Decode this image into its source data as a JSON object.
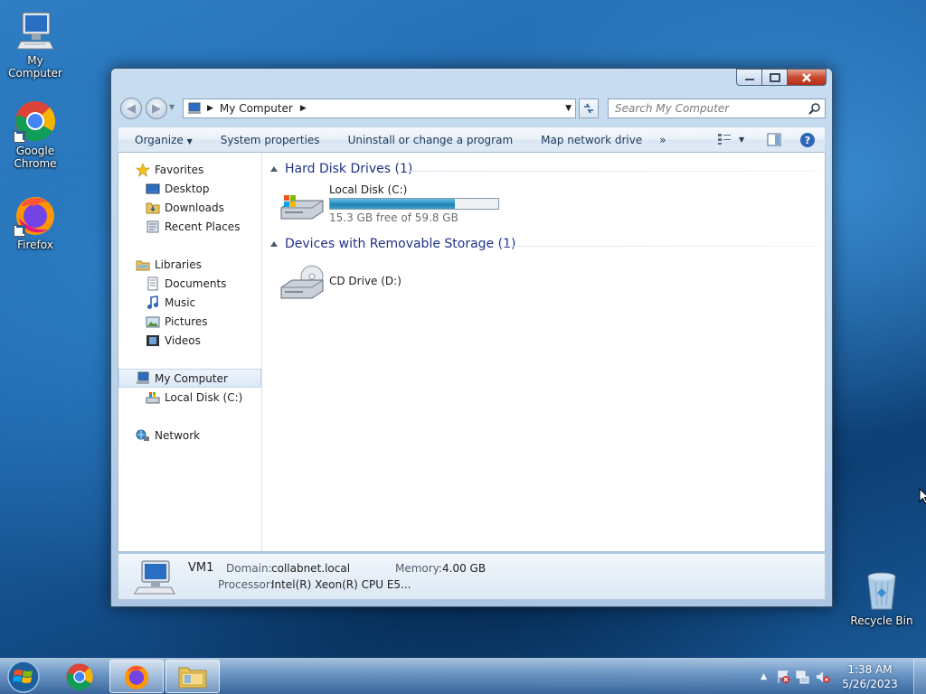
{
  "desktop": {
    "icons": [
      {
        "label": "My Computer",
        "icon": "computer-icon"
      },
      {
        "label": "Google Chrome",
        "icon": "chrome-icon"
      },
      {
        "label": "Firefox",
        "icon": "firefox-icon"
      },
      {
        "label": "Recycle Bin",
        "icon": "recycle-bin-icon"
      }
    ]
  },
  "window": {
    "title_buttons": [
      "minimize",
      "maximize",
      "close"
    ],
    "address": {
      "location": "My Computer"
    },
    "search": {
      "placeholder": "Search My Computer"
    },
    "toolbar": {
      "organize": "Organize",
      "system_properties": "System properties",
      "uninstall": "Uninstall or change a program",
      "map_drive": "Map network drive",
      "more": "»"
    },
    "nav": {
      "favorites": "Favorites",
      "desktop": "Desktop",
      "downloads": "Downloads",
      "recent": "Recent Places",
      "libraries": "Libraries",
      "documents": "Documents",
      "music": "Music",
      "pictures": "Pictures",
      "videos": "Videos",
      "computer": "My Computer",
      "local_disk": "Local Disk (C:)",
      "network": "Network"
    },
    "groups": {
      "hdd": "Hard Disk Drives (1)",
      "removable": "Devices with Removable Storage (1)"
    },
    "drives": {
      "c_name": "Local Disk (C:)",
      "c_free": "15.3 GB free of 59.8 GB",
      "c_used_fraction": 0.744,
      "d_name": "CD Drive (D:)"
    },
    "details": {
      "name": "VM1",
      "domain_label": "Domain:",
      "domain": "collabnet.local",
      "memory_label": "Memory:",
      "memory": "4.00 GB",
      "processor_label": "Processor:",
      "processor": "Intel(R) Xeon(R) CPU E5..."
    }
  },
  "taskbar": {
    "apps": [
      "chrome-icon",
      "firefox-icon",
      "explorer-icon"
    ],
    "time": "1:38 AM",
    "date": "5/26/2023"
  },
  "colors": {
    "group_header": "#1e3287",
    "toolbar_text": "#1e395b",
    "progress": "#2a8fc0"
  }
}
